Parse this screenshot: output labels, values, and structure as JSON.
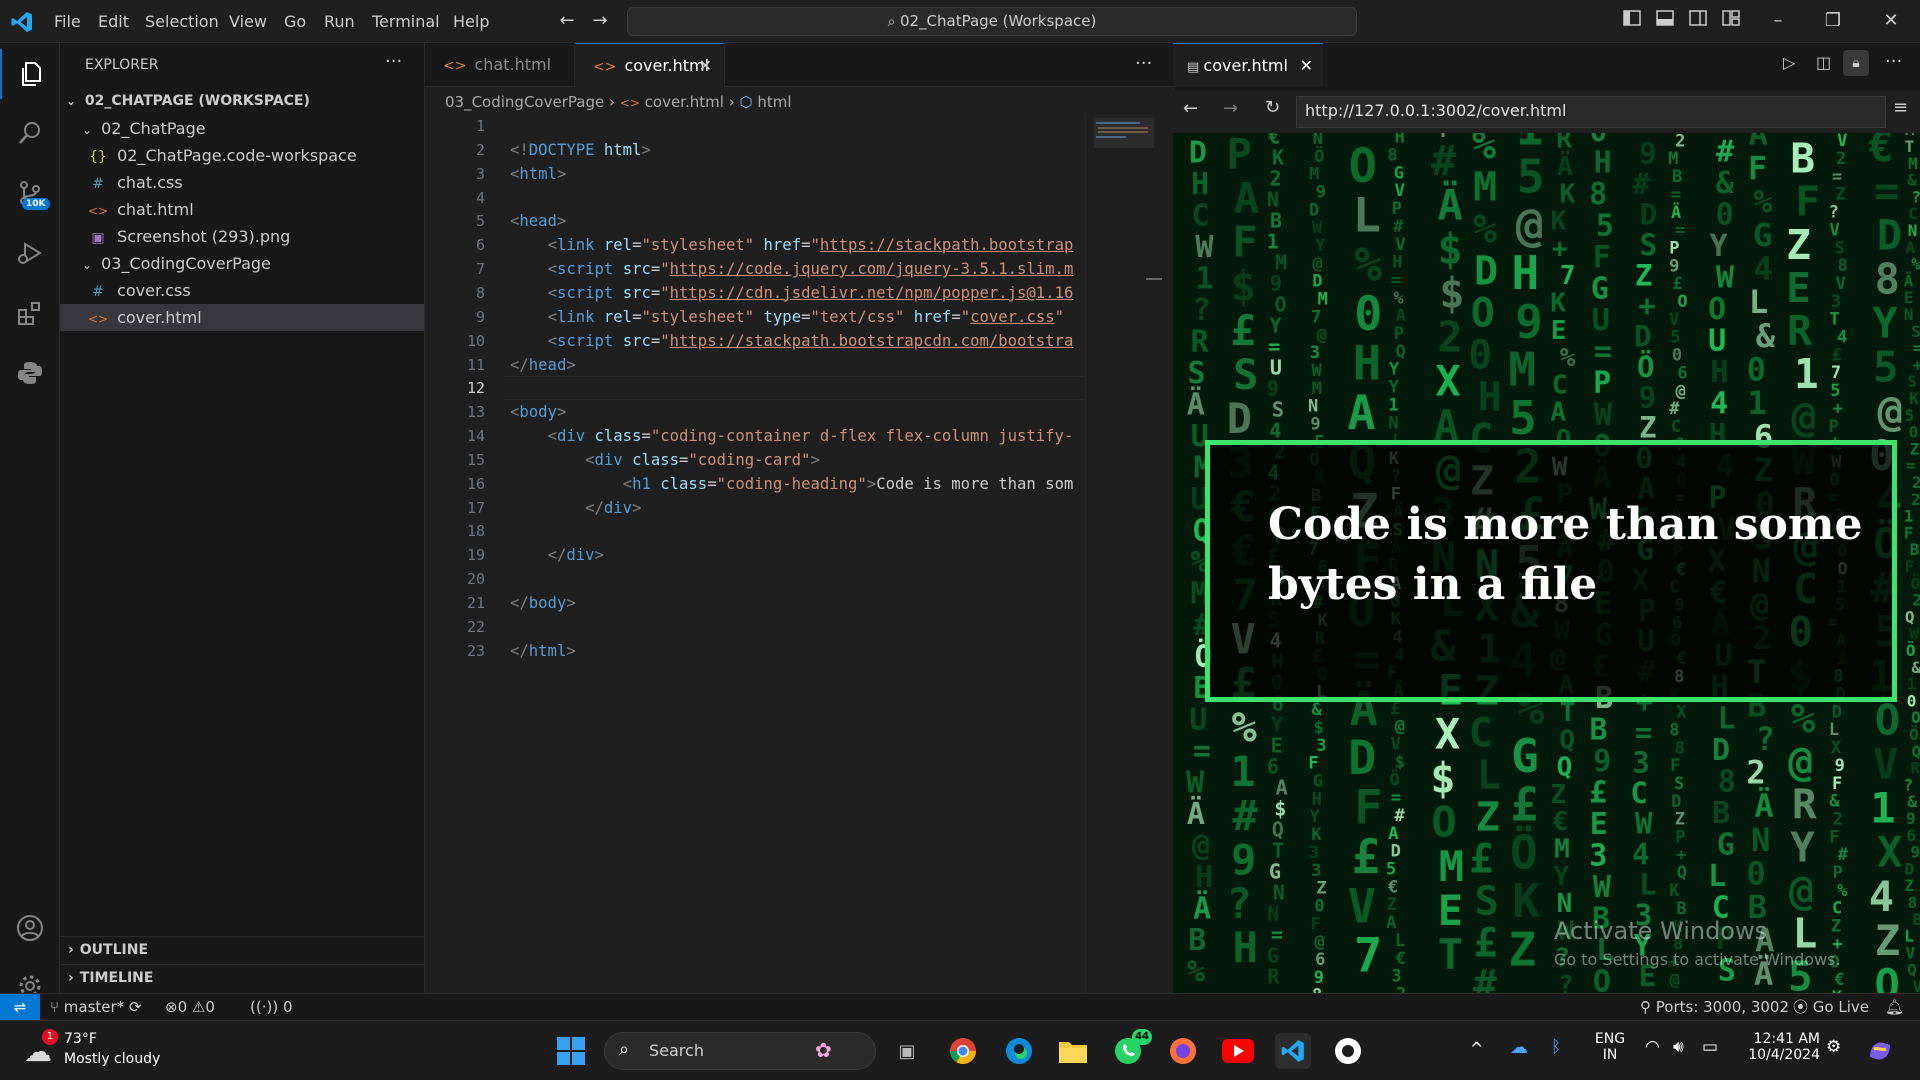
{
  "titlebar": {
    "menus": [
      "File",
      "Edit",
      "Selection",
      "View",
      "Go",
      "Run",
      "Terminal",
      "Help"
    ],
    "command_center": "02_ChatPage (Workspace)",
    "icons": [
      "vscode-logo-icon",
      "back-arrow-icon",
      "forward-arrow-icon",
      "search-icon",
      "toggle-primary-sidebar-icon",
      "toggle-panel-icon",
      "toggle-secondary-sidebar-icon",
      "customize-layout-icon",
      "minimize-icon",
      "restore-icon",
      "close-icon"
    ]
  },
  "activity_bar": {
    "items": [
      "explorer-icon",
      "search-icon",
      "source-control-icon",
      "run-debug-icon",
      "extensions-icon",
      "python-icon",
      "accounts-icon",
      "manage-gear-icon"
    ],
    "scm_badge": "10K"
  },
  "explorer": {
    "title": "EXPLORER",
    "workspace": "02_CHATPAGE (WORKSPACE)",
    "items": [
      {
        "label": "02_ChatPage",
        "type": "folder"
      },
      {
        "label": "02_ChatPage.code-workspace",
        "type": "json",
        "icon": "{}"
      },
      {
        "label": "chat.css",
        "type": "css",
        "icon": "#"
      },
      {
        "label": "chat.html",
        "type": "html",
        "icon": "<>"
      },
      {
        "label": "Screenshot (293).png",
        "type": "image",
        "icon": "▣"
      },
      {
        "label": "03_CodingCoverPage",
        "type": "folder"
      },
      {
        "label": "cover.css",
        "type": "css",
        "icon": "#"
      },
      {
        "label": "cover.html",
        "type": "html",
        "icon": "<>"
      }
    ],
    "outline": "OUTLINE",
    "timeline": "TIMELINE"
  },
  "editor": {
    "tabs": [
      {
        "label": "chat.html",
        "active": false
      },
      {
        "label": "cover.html",
        "active": true
      }
    ],
    "breadcrumb": [
      "03_CodingCoverPage",
      "cover.html",
      "html"
    ],
    "current_line": 12,
    "line_numbers": [
      "1",
      "2",
      "3",
      "4",
      "5",
      "6",
      "7",
      "8",
      "9",
      "10",
      "11",
      "12",
      "13",
      "14",
      "15",
      "16",
      "17",
      "18",
      "19",
      "20",
      "21",
      "22",
      "23"
    ]
  },
  "code": [
    {
      "line": 1,
      "tokens": []
    },
    {
      "line": 2,
      "tokens": [
        {
          "t": "brk",
          "v": "<!"
        },
        {
          "t": "tag",
          "v": "DOCTYPE"
        },
        {
          "t": "txt",
          "v": " "
        },
        {
          "t": "attr",
          "v": "html"
        },
        {
          "t": "brk",
          "v": ">"
        }
      ]
    },
    {
      "line": 3,
      "tokens": [
        {
          "t": "brk",
          "v": "<"
        },
        {
          "t": "tag",
          "v": "html"
        },
        {
          "t": "brk",
          "v": ">"
        }
      ]
    },
    {
      "line": 4,
      "tokens": []
    },
    {
      "line": 5,
      "tokens": [
        {
          "t": "brk",
          "v": "<"
        },
        {
          "t": "tag",
          "v": "head"
        },
        {
          "t": "brk",
          "v": ">"
        }
      ]
    },
    {
      "line": 6,
      "tokens": [
        {
          "t": "txt",
          "v": "    "
        },
        {
          "t": "brk",
          "v": "<"
        },
        {
          "t": "tag",
          "v": "link"
        },
        {
          "t": "txt",
          "v": " "
        },
        {
          "t": "attr",
          "v": "rel"
        },
        {
          "t": "txt",
          "v": "="
        },
        {
          "t": "str",
          "v": "\"stylesheet\""
        },
        {
          "t": "txt",
          "v": " "
        },
        {
          "t": "attr",
          "v": "href"
        },
        {
          "t": "txt",
          "v": "="
        },
        {
          "t": "str",
          "v": "\""
        },
        {
          "t": "url",
          "v": "https://stackpath.bootstrap"
        }
      ]
    },
    {
      "line": 7,
      "tokens": [
        {
          "t": "txt",
          "v": "    "
        },
        {
          "t": "brk",
          "v": "<"
        },
        {
          "t": "tag",
          "v": "script"
        },
        {
          "t": "txt",
          "v": " "
        },
        {
          "t": "attr",
          "v": "src"
        },
        {
          "t": "txt",
          "v": "="
        },
        {
          "t": "str",
          "v": "\""
        },
        {
          "t": "url",
          "v": "https://code.jquery.com/jquery-3.5.1.slim.m"
        }
      ]
    },
    {
      "line": 8,
      "tokens": [
        {
          "t": "txt",
          "v": "    "
        },
        {
          "t": "brk",
          "v": "<"
        },
        {
          "t": "tag",
          "v": "script"
        },
        {
          "t": "txt",
          "v": " "
        },
        {
          "t": "attr",
          "v": "src"
        },
        {
          "t": "txt",
          "v": "="
        },
        {
          "t": "str",
          "v": "\""
        },
        {
          "t": "url",
          "v": "https://cdn.jsdelivr.net/npm/popper.js@1.16"
        }
      ]
    },
    {
      "line": 9,
      "tokens": [
        {
          "t": "txt",
          "v": "    "
        },
        {
          "t": "brk",
          "v": "<"
        },
        {
          "t": "tag",
          "v": "link"
        },
        {
          "t": "txt",
          "v": " "
        },
        {
          "t": "attr",
          "v": "rel"
        },
        {
          "t": "txt",
          "v": "="
        },
        {
          "t": "str",
          "v": "\"stylesheet\""
        },
        {
          "t": "txt",
          "v": " "
        },
        {
          "t": "attr",
          "v": "type"
        },
        {
          "t": "txt",
          "v": "="
        },
        {
          "t": "str",
          "v": "\"text/css\""
        },
        {
          "t": "txt",
          "v": " "
        },
        {
          "t": "attr",
          "v": "href"
        },
        {
          "t": "txt",
          "v": "="
        },
        {
          "t": "str",
          "v": "\""
        },
        {
          "t": "url",
          "v": "cover.css"
        },
        {
          "t": "str",
          "v": "\""
        }
      ]
    },
    {
      "line": 10,
      "tokens": [
        {
          "t": "txt",
          "v": "    "
        },
        {
          "t": "brk",
          "v": "<"
        },
        {
          "t": "tag",
          "v": "script"
        },
        {
          "t": "txt",
          "v": " "
        },
        {
          "t": "attr",
          "v": "src"
        },
        {
          "t": "txt",
          "v": "="
        },
        {
          "t": "str",
          "v": "\""
        },
        {
          "t": "url",
          "v": "https://stackpath.bootstrapcdn.com/bootstra"
        }
      ]
    },
    {
      "line": 11,
      "tokens": [
        {
          "t": "brk",
          "v": "</"
        },
        {
          "t": "tag",
          "v": "head"
        },
        {
          "t": "brk",
          "v": ">"
        }
      ]
    },
    {
      "line": 12,
      "tokens": []
    },
    {
      "line": 13,
      "tokens": [
        {
          "t": "brk",
          "v": "<"
        },
        {
          "t": "tag",
          "v": "body"
        },
        {
          "t": "brk",
          "v": ">"
        }
      ]
    },
    {
      "line": 14,
      "tokens": [
        {
          "t": "txt",
          "v": "    "
        },
        {
          "t": "brk",
          "v": "<"
        },
        {
          "t": "tag",
          "v": "div"
        },
        {
          "t": "txt",
          "v": " "
        },
        {
          "t": "attr",
          "v": "class"
        },
        {
          "t": "txt",
          "v": "="
        },
        {
          "t": "str",
          "v": "\"coding-container d-flex flex-column justify-"
        }
      ]
    },
    {
      "line": 15,
      "tokens": [
        {
          "t": "txt",
          "v": "        "
        },
        {
          "t": "brk",
          "v": "<"
        },
        {
          "t": "tag",
          "v": "div"
        },
        {
          "t": "txt",
          "v": " "
        },
        {
          "t": "attr",
          "v": "class"
        },
        {
          "t": "txt",
          "v": "="
        },
        {
          "t": "str",
          "v": "\"coding-card\""
        },
        {
          "t": "brk",
          "v": ">"
        }
      ]
    },
    {
      "line": 16,
      "tokens": [
        {
          "t": "txt",
          "v": "            "
        },
        {
          "t": "brk",
          "v": "<"
        },
        {
          "t": "tag",
          "v": "h1"
        },
        {
          "t": "txt",
          "v": " "
        },
        {
          "t": "attr",
          "v": "class"
        },
        {
          "t": "txt",
          "v": "="
        },
        {
          "t": "str",
          "v": "\"coding-heading\""
        },
        {
          "t": "brk",
          "v": ">"
        },
        {
          "t": "txt",
          "v": "Code is more than som"
        }
      ]
    },
    {
      "line": 17,
      "tokens": [
        {
          "t": "txt",
          "v": "        "
        },
        {
          "t": "brk",
          "v": "</"
        },
        {
          "t": "tag",
          "v": "div"
        },
        {
          "t": "brk",
          "v": ">"
        }
      ]
    },
    {
      "line": 18,
      "tokens": []
    },
    {
      "line": 19,
      "tokens": [
        {
          "t": "txt",
          "v": "    "
        },
        {
          "t": "brk",
          "v": "</"
        },
        {
          "t": "tag",
          "v": "div"
        },
        {
          "t": "brk",
          "v": ">"
        }
      ]
    },
    {
      "line": 20,
      "tokens": []
    },
    {
      "line": 21,
      "tokens": [
        {
          "t": "brk",
          "v": "</"
        },
        {
          "t": "tag",
          "v": "body"
        },
        {
          "t": "brk",
          "v": ">"
        }
      ]
    },
    {
      "line": 22,
      "tokens": []
    },
    {
      "line": 23,
      "tokens": [
        {
          "t": "brk",
          "v": "</"
        },
        {
          "t": "tag",
          "v": "html"
        },
        {
          "t": "brk",
          "v": ">"
        }
      ]
    }
  ],
  "preview": {
    "tab_label": "cover.html",
    "url": "http://127.0.0.1:3002/cover.html",
    "heading": "Code is more than some bytes in a file",
    "watermark_title": "Activate Windows",
    "watermark_sub": "Go to Settings to activate Windows."
  },
  "statusbar": {
    "branch": "master*",
    "errors": "0",
    "warnings": "0",
    "ports_count": "0",
    "ports": "Ports: 3000, 3002",
    "go_live": "Go Live"
  },
  "taskbar": {
    "weather_temp": "73°F",
    "weather_desc": "Mostly cloudy",
    "weather_badge": "1",
    "search_placeholder": "Search",
    "whatsapp_badge": "44",
    "lang_top": "ENG",
    "lang_bottom": "IN",
    "time": "12:41 AM",
    "date": "10/4/2024"
  },
  "colors": {
    "accent": "#0078d4",
    "card_border": "#3ee36b",
    "matrix_green": "#18c24a"
  }
}
